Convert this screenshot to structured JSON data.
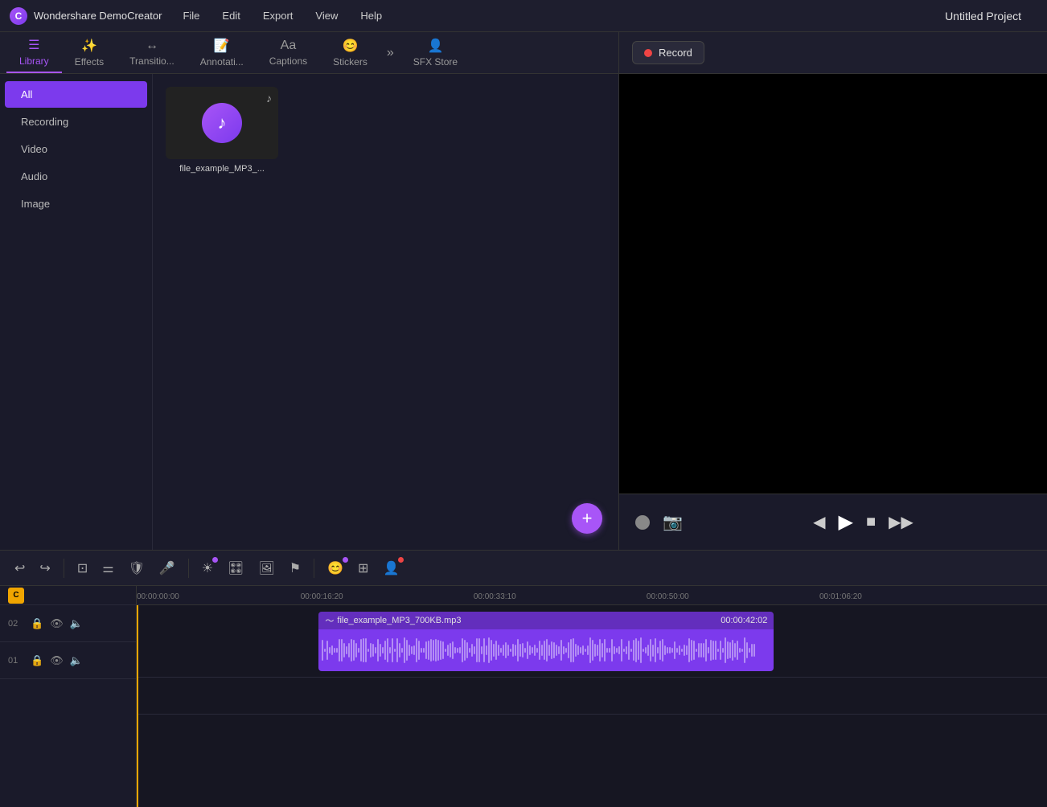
{
  "app": {
    "logo_text": "C",
    "name": "Wondershare DemoCreator",
    "project_title": "Untitled Project"
  },
  "menu": {
    "items": [
      "File",
      "Edit",
      "Export",
      "View",
      "Help"
    ]
  },
  "tabs": {
    "items": [
      {
        "id": "library",
        "label": "Library",
        "icon": "☰",
        "active": true
      },
      {
        "id": "effects",
        "label": "Effects",
        "icon": "✨"
      },
      {
        "id": "transitions",
        "label": "Transitio...",
        "icon": "▶"
      },
      {
        "id": "annotations",
        "label": "Annotati...",
        "icon": "📋"
      },
      {
        "id": "captions",
        "label": "Captions",
        "icon": "Aa"
      },
      {
        "id": "stickers",
        "label": "Stickers",
        "icon": "😊"
      }
    ],
    "more_icon": "»",
    "sfx_store": {
      "label": "SFX Store",
      "icon": "👤"
    }
  },
  "sidebar": {
    "items": [
      {
        "id": "all",
        "label": "All",
        "active": true
      },
      {
        "id": "recording",
        "label": "Recording"
      },
      {
        "id": "video",
        "label": "Video"
      },
      {
        "id": "audio",
        "label": "Audio"
      },
      {
        "id": "image",
        "label": "Image"
      }
    ]
  },
  "media_grid": {
    "items": [
      {
        "name": "file_example_MP3_...",
        "thumb_type": "audio",
        "note_icon": "♪"
      }
    ],
    "add_button_label": "+"
  },
  "record": {
    "button_label": "Record"
  },
  "preview": {
    "screenshot_icon": "📷",
    "controls": {
      "prev_icon": "◀",
      "play_icon": "▶",
      "stop_icon": "■",
      "next_icon": "▶▶"
    }
  },
  "toolbar": {
    "undo_icon": "↩",
    "redo_icon": "↪",
    "crop_icon": "⊡",
    "split_icon": "⚌",
    "shield_icon": "🛡",
    "mic_icon": "🎤",
    "sun_icon": "☀",
    "tune_icon": "🎛",
    "image_icon": "🖼",
    "flag_icon": "⚑",
    "face_icon": "😊",
    "adjust_icon": "⊞",
    "user_icon": "👤"
  },
  "timeline": {
    "ruler": {
      "marks": [
        {
          "label": "00:00:00:00",
          "pos_pct": 0
        },
        {
          "label": "00:00:16:20",
          "pos_pct": 18
        },
        {
          "label": "00:00:33:10",
          "pos_pct": 37
        },
        {
          "label": "00:00:50:00",
          "pos_pct": 56
        },
        {
          "label": "00:01:06:20",
          "pos_pct": 75
        }
      ]
    },
    "playhead_time": "C",
    "tracks": [
      {
        "num": "02",
        "type": "audio",
        "clips": [
          {
            "name": "file_example_MP3_700KB.mp3",
            "duration": "00:00:42:02",
            "start_pct": 20,
            "width_pct": 50
          }
        ]
      },
      {
        "num": "01",
        "type": "empty",
        "clips": []
      }
    ]
  }
}
